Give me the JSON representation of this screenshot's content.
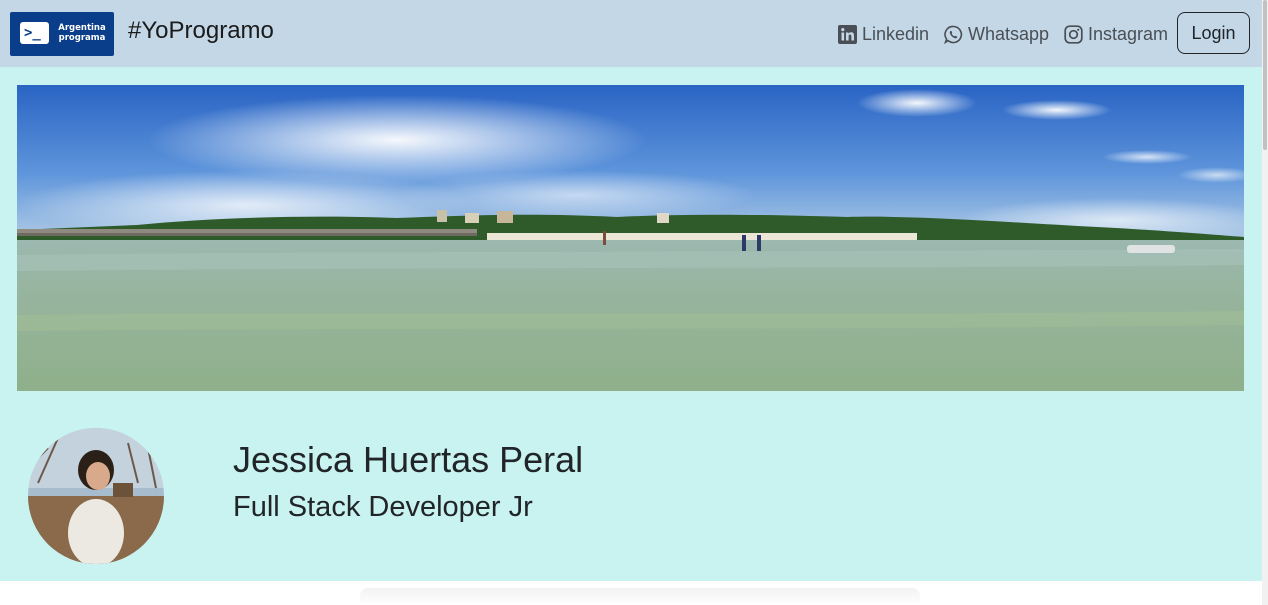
{
  "navbar": {
    "logo_line1": "Argentina",
    "logo_line2": "programa",
    "logo_symbol": ">_",
    "brand": "#YoProgramo",
    "links": [
      {
        "label": "Linkedin",
        "icon": "linkedin-icon"
      },
      {
        "label": "Whatsapp",
        "icon": "whatsapp-icon"
      },
      {
        "label": "Instagram",
        "icon": "instagram-icon"
      }
    ],
    "login_label": "Login"
  },
  "profile": {
    "name": "Jessica Huertas Peral",
    "role": "Full Stack Developer Jr"
  },
  "colors": {
    "navbar_bg": "#c3d7e6",
    "section_bg": "#c9f3f0",
    "logo_bg": "#0b3e8a"
  }
}
